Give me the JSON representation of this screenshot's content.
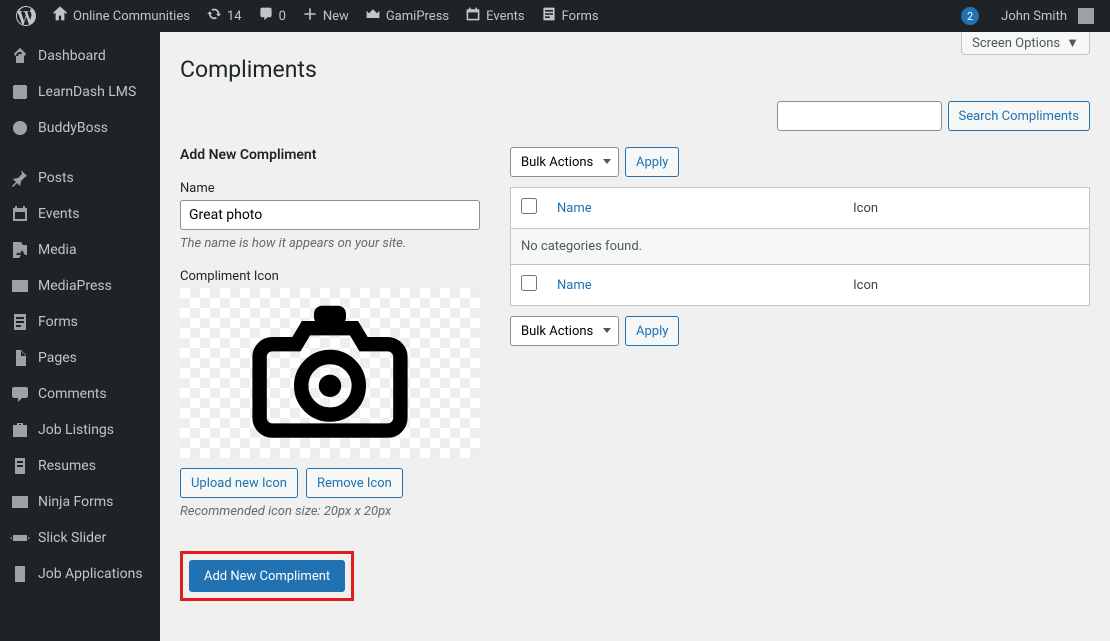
{
  "topbar": {
    "site_name": "Online Communities",
    "updates_count": "14",
    "comments_count": "0",
    "new_label": "New",
    "gamipress": "GamiPress",
    "events": "Events",
    "forms": "Forms",
    "notif_count": "2",
    "user_name": "John Smith"
  },
  "sidebar": {
    "items": [
      {
        "label": "Dashboard"
      },
      {
        "label": "LearnDash LMS"
      },
      {
        "label": "BuddyBoss"
      },
      {
        "label": "Posts"
      },
      {
        "label": "Events"
      },
      {
        "label": "Media"
      },
      {
        "label": "MediaPress"
      },
      {
        "label": "Forms"
      },
      {
        "label": "Pages"
      },
      {
        "label": "Comments"
      },
      {
        "label": "Job Listings"
      },
      {
        "label": "Resumes"
      },
      {
        "label": "Ninja Forms"
      },
      {
        "label": "Slick Slider"
      },
      {
        "label": "Job Applications"
      }
    ]
  },
  "page": {
    "screen_options": "Screen Options",
    "title": "Compliments",
    "search_button": "Search Compliments",
    "form": {
      "heading": "Add New Compliment",
      "name_label": "Name",
      "name_value": "Great photo",
      "name_desc": "The name is how it appears on your site.",
      "icon_label": "Compliment Icon",
      "upload_btn": "Upload new Icon",
      "remove_btn": "Remove Icon",
      "icon_size_desc": "Recommended icon size: 20px x 20px",
      "submit_btn": "Add New Compliment"
    },
    "table": {
      "bulk_actions": "Bulk Actions",
      "apply": "Apply",
      "col_name": "Name",
      "col_icon": "Icon",
      "empty": "No categories found."
    }
  }
}
